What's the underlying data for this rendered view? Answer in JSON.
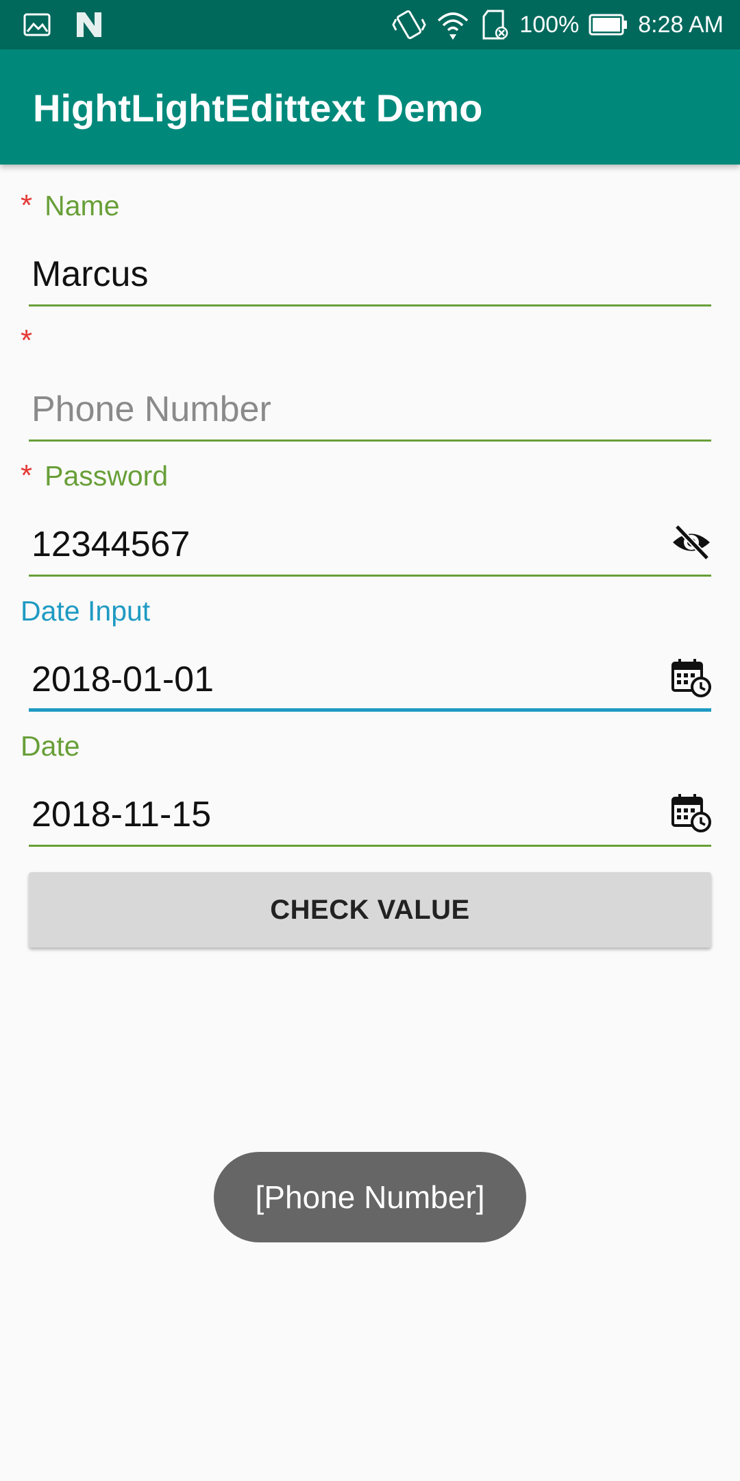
{
  "status_bar": {
    "battery": "100%",
    "time": "8:28 AM",
    "icons": [
      "image-icon",
      "n-logo-icon",
      "vibrate-icon",
      "wifi-icon",
      "sd-card-icon",
      "battery-icon"
    ]
  },
  "app_bar": {
    "title": "HightLightEdittext Demo"
  },
  "fields": [
    {
      "label": "Name",
      "required": true,
      "value": "Marcus",
      "placeholder": ""
    },
    {
      "label": "",
      "required": true,
      "value": "",
      "placeholder": "Phone Number"
    },
    {
      "label": "Password",
      "required": true,
      "value": "12344567",
      "placeholder": "",
      "trailing_icon": "visibility-off-icon"
    },
    {
      "label": "Date Input",
      "required": false,
      "value": "2018-01-01",
      "placeholder": "",
      "trailing_icon": "calendar-clock-icon",
      "focused": true
    },
    {
      "label": "Date",
      "required": false,
      "value": "2018-11-15",
      "placeholder": "",
      "trailing_icon": "calendar-clock-icon"
    }
  ],
  "required_marker": "*",
  "button": {
    "label": "CHECK VALUE"
  },
  "toast": {
    "text": "[Phone Number]"
  },
  "colors": {
    "status_bar": "#00695c",
    "app_bar": "#00897b",
    "label_green": "#689f38",
    "label_focus_blue": "#1e9ac2",
    "required_red": "#e53935",
    "button_bg": "#d8d8d8",
    "toast_bg": "#666666"
  }
}
